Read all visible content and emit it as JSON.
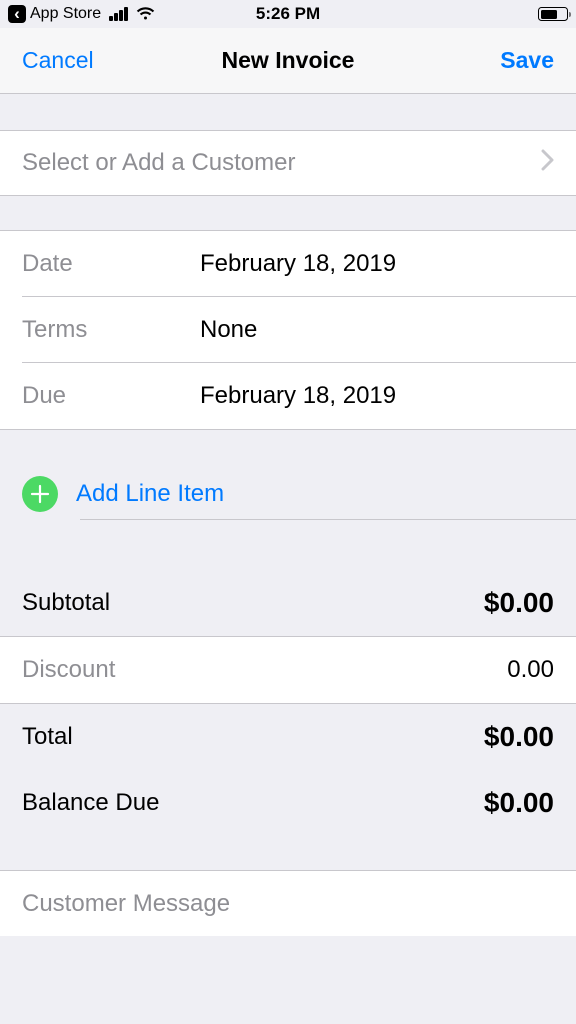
{
  "status": {
    "app_label": "App Store",
    "time": "5:26 PM"
  },
  "nav": {
    "cancel": "Cancel",
    "title": "New Invoice",
    "save": "Save"
  },
  "customer": {
    "placeholder": "Select or Add a Customer"
  },
  "details": {
    "date_label": "Date",
    "date_value": "February 18, 2019",
    "terms_label": "Terms",
    "terms_value": "None",
    "due_label": "Due",
    "due_value": "February 18, 2019"
  },
  "line_item": {
    "add_label": "Add Line Item"
  },
  "totals": {
    "subtotal_label": "Subtotal",
    "subtotal_value": "$0.00",
    "discount_label": "Discount",
    "discount_value": "0.00",
    "total_label": "Total",
    "total_value": "$0.00",
    "balance_label": "Balance Due",
    "balance_value": "$0.00"
  },
  "message": {
    "placeholder": "Customer Message"
  }
}
